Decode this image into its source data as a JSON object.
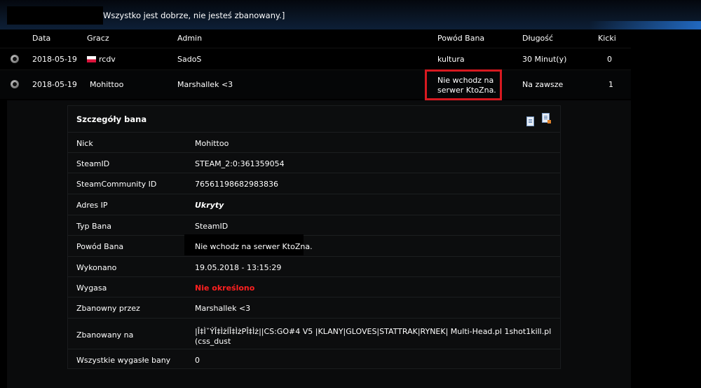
{
  "status_message": "Wszystko jest dobrze, nie jesteś zbanowany.]",
  "table": {
    "headers": {
      "date": "Data",
      "player": "Gracz",
      "admin": "Admin",
      "reason": "Powód Bana",
      "length": "Długość",
      "kicks": "Kicki"
    },
    "rows": [
      {
        "date": "2018-05-19",
        "player": "rcdv",
        "admin": "SadoS",
        "reason": "kultura",
        "length": "30 Minut(y)",
        "kicks": "0",
        "game_icon": "csgo-icon",
        "flag": "poland-flag"
      },
      {
        "date": "2018-05-19",
        "player": "Mohittoo",
        "admin": "Marshallek <3",
        "reason_line1": "Nie wchodz na",
        "reason_line2": "serwer KtoZna.",
        "length": "Na zawsze",
        "kicks": "1",
        "game_icon": "csgo-icon"
      }
    ]
  },
  "details": {
    "title": "Szczegóły bana",
    "icons": [
      "document-icon",
      "edit-document-icon"
    ],
    "fields": [
      {
        "label": "Nick",
        "value": "Mohittoo"
      },
      {
        "label": "SteamID",
        "value": "STEAM_2:0:361359054"
      },
      {
        "label": "SteamCommunity ID",
        "value": "76561198682983836"
      },
      {
        "label": "Adres IP",
        "value": "Ukryty"
      },
      {
        "label": "Typ Bana",
        "value": "SteamID"
      },
      {
        "label": "Powód Bana",
        "value": "Nie wchodz na serwer KtoZna."
      },
      {
        "label": "Wykonano",
        "value": "19.05.2018 - 13:15:29"
      },
      {
        "label": "Wygasa",
        "value": "Nie określono"
      },
      {
        "label": "Zbanowny przez",
        "value": "Marshallek <3"
      },
      {
        "label": "Zbanowany na",
        "value": "|Î‡ÌˇÝÎ‡ÌżÍÎ‡ÌżPÎ‡Ìż||CS:GO#4 V5 |KLANY|GLOVES|STATTRAK|RYNEK| Multi-Head.pl 1shot1kill.pl (css_dust"
      },
      {
        "label": "Wszystkie wygasłe bany",
        "value": "0"
      }
    ]
  },
  "colors": {
    "highlight_border": "#d71920",
    "expires_text": "#ff2020",
    "header_glow": "#2882f0"
  }
}
